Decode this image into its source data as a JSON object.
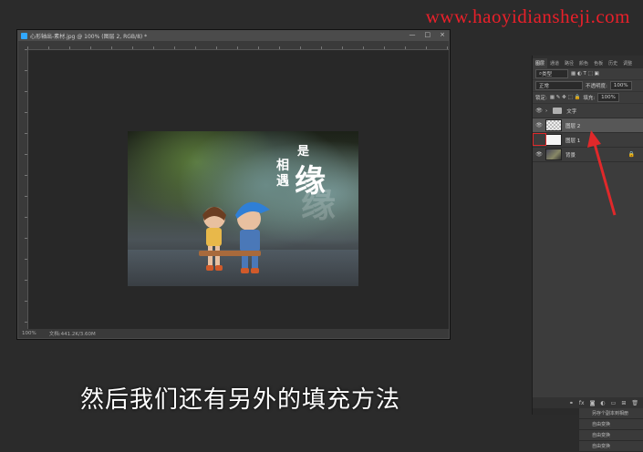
{
  "watermark": "www.haoyidiansheji.com",
  "document": {
    "title": "心形轴出-素材.jpg @ 100% (图层 2, RGB/8) *",
    "window_buttons": [
      "—",
      "□",
      "×"
    ],
    "zoom": "100%",
    "status": "文档:441.2K/3.60M"
  },
  "photo_text": {
    "shi": "是",
    "xiang": "相",
    "yu": "遇",
    "yuan": "缘",
    "yuan_ghost": "缘"
  },
  "layers_panel": {
    "tabs": [
      "图层",
      "通道",
      "路径",
      "颜色",
      "色板",
      "历史",
      "调整"
    ],
    "filter_label": "类型",
    "blend_mode": "正常",
    "opacity_label": "不透明度:",
    "opacity_value": "100%",
    "lock_label": "锁定:",
    "fill_label": "填充:",
    "fill_value": "100%",
    "layers": [
      {
        "name": "文字",
        "type": "group"
      },
      {
        "name": "图层 2",
        "type": "layer",
        "selected": true
      },
      {
        "name": "图层 1",
        "type": "layer",
        "eye_off": true
      },
      {
        "name": "背景",
        "type": "background"
      }
    ],
    "bottom_icons": [
      "fx",
      "mask",
      "adjust",
      "folder",
      "new",
      "trash"
    ]
  },
  "mini_list": [
    "另存个副本到相册",
    "自由变换",
    "自由变换",
    "自由变换"
  ],
  "subtitle": "然后我们还有另外的填充方法",
  "colors": {
    "accent_red": "#e0282a",
    "ps_blue": "#31a8ff"
  }
}
